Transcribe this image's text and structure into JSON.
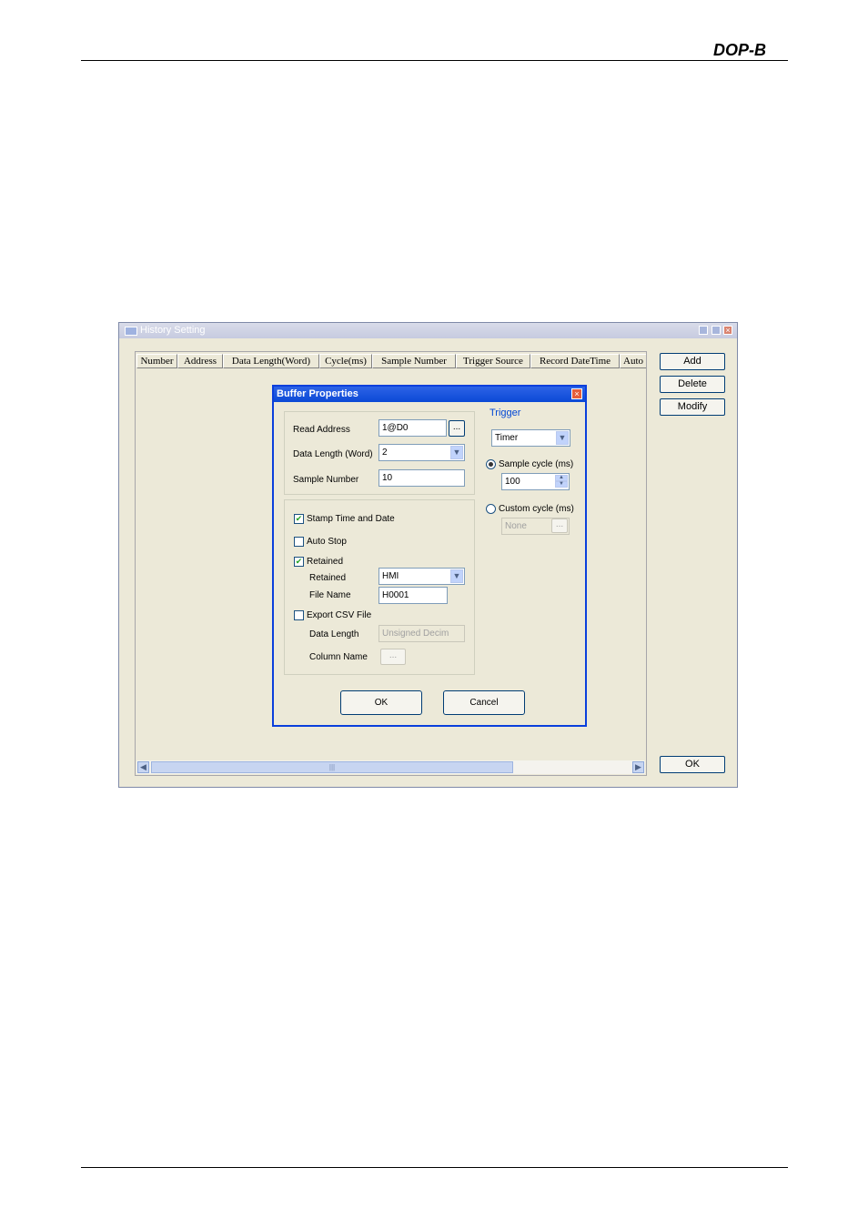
{
  "page": {
    "logo_text": "DOP-B"
  },
  "history_window": {
    "title": "History Setting",
    "columns": [
      "Number",
      "Address",
      "Data Length(Word)",
      "Cycle(ms)",
      "Sample Number",
      "Trigger Source",
      "Record DateTime",
      "Auto"
    ],
    "buttons": {
      "add": "Add",
      "delete": "Delete",
      "modify": "Modify",
      "ok": "OK"
    }
  },
  "dialog": {
    "title": "Buffer Properties",
    "read_address": {
      "label": "Read Address",
      "value": "1@D0",
      "browse": "..."
    },
    "data_length": {
      "label": "Data Length (Word)",
      "value": "2"
    },
    "sample_number": {
      "label": "Sample Number",
      "value": "10"
    },
    "stamp_time": {
      "label": "Stamp Time and Date",
      "checked": true
    },
    "auto_stop": {
      "label": "Auto Stop",
      "checked": false
    },
    "retained": {
      "label": "Retained",
      "checked": true
    },
    "retained_location": {
      "label": "Retained",
      "value": "HMI"
    },
    "file_name": {
      "label": "File Name",
      "value": "H0001"
    },
    "export_csv": {
      "label": "Export CSV File",
      "checked": false
    },
    "csv_data_length": {
      "label": "Data Length",
      "value": "Unsigned Decim"
    },
    "column_name": {
      "label": "Column Name",
      "value": "..."
    },
    "trigger": {
      "label": "Trigger",
      "value": "Timer",
      "sample_cycle": {
        "label": "Sample cycle (ms)",
        "value": "100",
        "selected": true
      },
      "custom_cycle": {
        "label": "Custom cycle (ms)",
        "value": "None",
        "browse": "...",
        "selected": false
      }
    },
    "ok": "OK",
    "cancel": "Cancel"
  }
}
